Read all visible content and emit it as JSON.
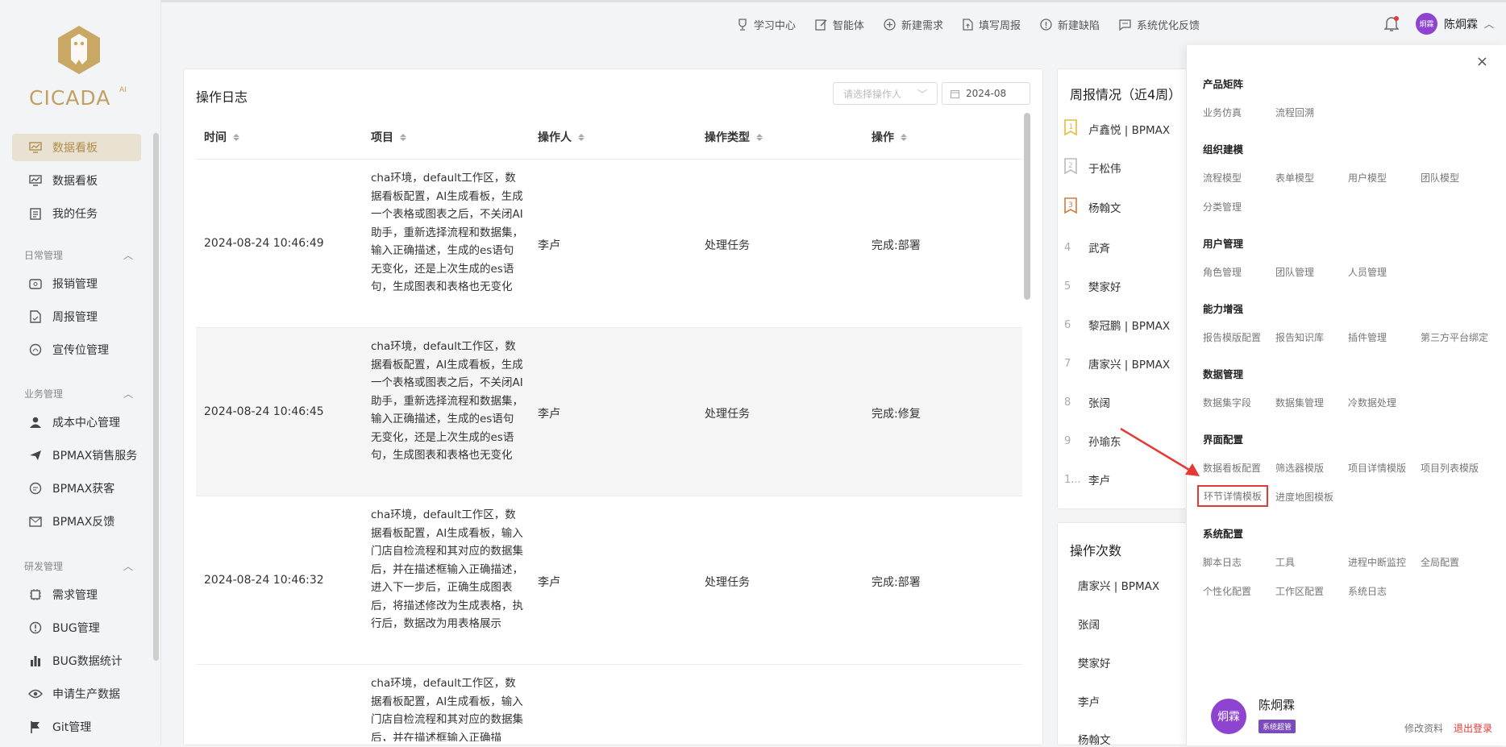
{
  "brand": {
    "name": "CICADA",
    "sup": "AI"
  },
  "sidebar": {
    "items": [
      {
        "label": "数据看板"
      },
      {
        "label": "数据看板"
      },
      {
        "label": "我的任务"
      }
    ],
    "groups": [
      {
        "title": "日常管理",
        "items": [
          {
            "label": "报销管理"
          },
          {
            "label": "周报管理"
          },
          {
            "label": "宣传位管理"
          }
        ]
      },
      {
        "title": "业务管理",
        "items": [
          {
            "label": "成本中心管理"
          },
          {
            "label": "BPMAX销售服务"
          },
          {
            "label": "BPMAX获客"
          },
          {
            "label": "BPMAX反馈"
          }
        ]
      },
      {
        "title": "研发管理",
        "items": [
          {
            "label": "需求管理"
          },
          {
            "label": "BUG管理"
          },
          {
            "label": "BUG数据统计"
          },
          {
            "label": "申请生产数据"
          },
          {
            "label": "Git管理"
          }
        ]
      }
    ]
  },
  "topbar": {
    "links": [
      "学习中心",
      "智能体",
      "新建需求",
      "填写周报",
      "新建缺陷",
      "系统优化反馈"
    ],
    "user": "陈炯霖",
    "avatar": "炯霖"
  },
  "oplog": {
    "title": "操作日志",
    "operator_placeholder": "请选择操作人",
    "date": "2024-08",
    "columns": [
      "时间",
      "项目",
      "操作人",
      "操作类型",
      "操作"
    ],
    "rows": [
      {
        "time": "2024-08-24 10:46:49",
        "project": "cha环境，default工作区，数据看板配置，AI生成看板，生成一个表格或图表之后，不关闭AI助手，重新选择流程和数据集，输入正确描述，生成的es语句无变化，还是上次生成的es语句，生成图表和表格也无变化",
        "user": "李卢",
        "type": "处理任务",
        "action": "完成:部署"
      },
      {
        "time": "2024-08-24 10:46:45",
        "project": "cha环境，default工作区，数据看板配置，AI生成看板，生成一个表格或图表之后，不关闭AI助手，重新选择流程和数据集，输入正确描述，生成的es语句无变化，还是上次生成的es语句，生成图表和表格也无变化",
        "user": "李卢",
        "type": "处理任务",
        "action": "完成:修复"
      },
      {
        "time": "2024-08-24 10:46:32",
        "project": "cha环境，default工作区，数据看板配置，AI生成看板，输入门店自检流程和其对应的数据集后，并在描述框输入正确描述，进入下一步后，正确生成图表后，将描述修改为生成表格，执行后，数据改为用表格展示",
        "user": "李卢",
        "type": "处理任务",
        "action": "完成:部署"
      },
      {
        "time": "",
        "project": "cha环境，default工作区，数据看板配置，AI生成看板，输入门店自检流程和其对应的数据集后，并在描述框输入正确描",
        "user": "",
        "type": "",
        "action": ""
      }
    ]
  },
  "weekly": {
    "title": "周报情况（近4周）",
    "ranks": [
      {
        "n": "",
        "name": "卢鑫悦 | BPMAX"
      },
      {
        "n": "",
        "name": "于松伟"
      },
      {
        "n": "",
        "name": "杨翰文"
      },
      {
        "n": "4",
        "name": "武斉"
      },
      {
        "n": "5",
        "name": "樊家好"
      },
      {
        "n": "6",
        "name": "黎冠鹏 | BPMAX"
      },
      {
        "n": "7",
        "name": "唐家兴 | BPMAX"
      },
      {
        "n": "8",
        "name": "张阔"
      },
      {
        "n": "9",
        "name": "孙瑜东"
      },
      {
        "n": "1...",
        "name": "李卢"
      }
    ]
  },
  "opcount": {
    "title": "操作次数",
    "names": [
      "唐家兴 | BPMAX",
      "张阔",
      "樊家好",
      "李卢",
      "杨翰文"
    ]
  },
  "drawer": {
    "sections": [
      {
        "title": "产品矩阵",
        "items": [
          "业务仿真",
          "流程回溯"
        ]
      },
      {
        "title": "组织建模",
        "items": [
          "流程模型",
          "表单模型",
          "用户模型",
          "团队模型",
          "分类管理"
        ]
      },
      {
        "title": "用户管理",
        "items": [
          "角色管理",
          "团队管理",
          "人员管理"
        ]
      },
      {
        "title": "能力增强",
        "items": [
          "报告模版配置",
          "报告知识库",
          "插件管理",
          "第三方平台绑定"
        ]
      },
      {
        "title": "数据管理",
        "items": [
          "数据集字段",
          "数据集管理",
          "冷数据处理"
        ]
      },
      {
        "title": "界面配置",
        "items": [
          "数据看板配置",
          "筛选器模版",
          "项目详情模版",
          "项目列表模版",
          "环节详情模板",
          "进度地图模板"
        ]
      },
      {
        "title": "系统配置",
        "items": [
          "脚本日志",
          "工具",
          "进程中断监控",
          "全局配置",
          "个性化配置",
          "工作区配置",
          "系统日志"
        ]
      }
    ],
    "user": {
      "name": "陈炯霖",
      "avatar": "炯霖",
      "role": "系统超管",
      "edit": "修改资料",
      "logout": "退出登录"
    }
  },
  "colors": {
    "accent": "#b08d4a",
    "highlight": "#e53935",
    "avatar": "#8e44d0"
  }
}
